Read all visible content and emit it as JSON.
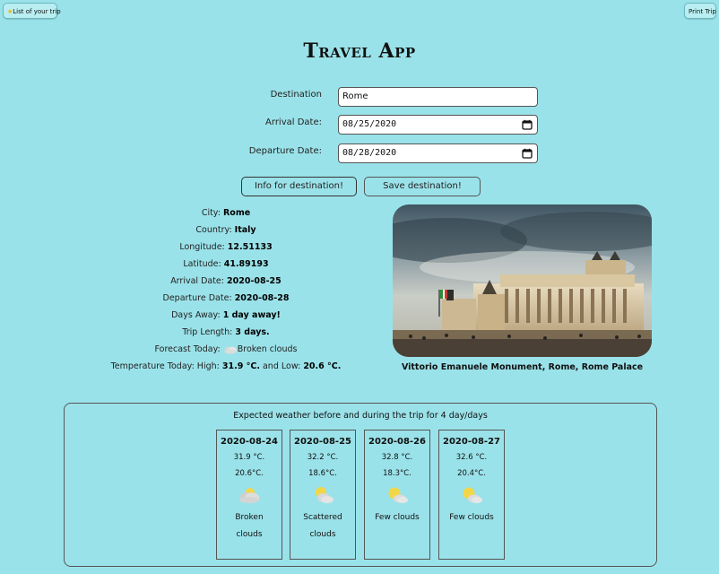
{
  "header": {
    "list_button": "List of your trip",
    "print_button": "Print Trip",
    "title": "Travel App"
  },
  "form": {
    "destination_label": "Destination",
    "destination_value": "Rome",
    "arrival_label": "Arrival Date:",
    "arrival_value": "08/25/2020",
    "departure_label": "Departure Date:",
    "departure_value": "08/28/2020"
  },
  "actions": {
    "info_button": "Info for destination!",
    "save_button": "Save destination!"
  },
  "info": {
    "city_label": "City:",
    "city": "Rome",
    "country_label": "Country:",
    "country": "Italy",
    "longitude_label": "Longitude:",
    "longitude": "12.51133",
    "latitude_label": "Latitude:",
    "latitude": "41.89193",
    "arrival_label": "Arrival Date:",
    "arrival": "2020-08-25",
    "departure_label": "Departure Date:",
    "departure": "2020-08-28",
    "days_away_label": "Days Away:",
    "days_away": "1 day away!",
    "trip_length_label": "Trip Length:",
    "trip_length": "3 days.",
    "forecast_label": "Forecast Today:",
    "forecast": "Broken clouds",
    "temperature_label": "Temperature Today: High:",
    "temp_high": "31.9 °C.",
    "temp_and_low": "and Low:",
    "temp_low": "20.6 °C."
  },
  "photo": {
    "caption": "Vittorio Emanuele Monument, Rome, Rome Palace"
  },
  "weather": {
    "title": "Expected weather before and during the trip for 4 day/days",
    "days": [
      {
        "date": "2020-08-24",
        "high": "31.9 °C.",
        "low": "20.6°C.",
        "desc1": "Broken",
        "desc2": "clouds",
        "icon": "broken-clouds-icon"
      },
      {
        "date": "2020-08-25",
        "high": "32.2 °C.",
        "low": "18.6°C.",
        "desc1": "Scattered",
        "desc2": "clouds",
        "icon": "scattered-clouds-icon"
      },
      {
        "date": "2020-08-26",
        "high": "32.8 °C.",
        "low": "18.3°C.",
        "desc1": "Few clouds",
        "desc2": "",
        "icon": "few-clouds-icon"
      },
      {
        "date": "2020-08-27",
        "high": "32.6 °C.",
        "low": "20.4°C.",
        "desc1": "Few clouds",
        "desc2": "",
        "icon": "few-clouds-icon"
      }
    ]
  },
  "colors": {
    "background": "#9ae2e9",
    "accent_star": "#f0b400"
  }
}
